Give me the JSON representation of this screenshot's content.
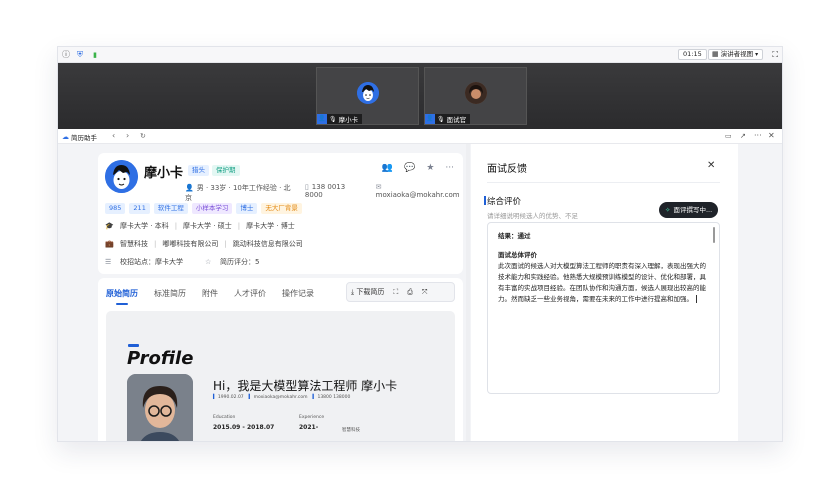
{
  "topbar": {
    "time": "01:15",
    "view_label": "演讲者视图",
    "view_caret": "▾"
  },
  "video": {
    "participants": [
      {
        "name": "摩小卡"
      },
      {
        "name": "面试官"
      }
    ]
  },
  "assistant": {
    "title": "简历助手"
  },
  "profile": {
    "name": "摩小卡",
    "badges": [
      "猎头",
      "保护期"
    ],
    "meta": {
      "basic": "男 · 33岁 · 10年工作经验 · 北京",
      "phone": "138 0013 8000",
      "email": "moxiaoka@mokahr.com"
    },
    "tags": [
      "985",
      "211",
      "软件工程",
      "小样本学习",
      "博士",
      "无大厂背景"
    ],
    "education": [
      "摩卡大学 · 本科",
      "摩卡大学 · 硕士",
      "摩卡大学 · 博士"
    ],
    "companies": [
      "智慧科技",
      "嘟嘟科技有限公司",
      "跳动科技信息有限公司"
    ],
    "site_label": "校招站点：摩卡大学",
    "score_label": "简历评分：5"
  },
  "resume": {
    "tabs": [
      "原始简历",
      "标准简历",
      "附件",
      "人才评价",
      "操作记录"
    ],
    "download_label": "下载简历",
    "preview": {
      "title": "Profile",
      "greeting": "Hi，我是大模型算法工程师 摩小卡",
      "birth": "1990.02.07",
      "email": "moxiaoka@mokahr.com",
      "phone": "13800 138000",
      "education_head": "Education",
      "education_date": "2015.09 - 2018.07",
      "experience_head": "Experience",
      "experience_date": "2021-",
      "experience_company": "智慧科技"
    }
  },
  "feedback": {
    "title": "面试反馈",
    "section": "综合评价",
    "hint": "请详细说明候选人的优势、不足",
    "writing_label": "面评撰写中...",
    "result_line": "结果：通过",
    "summary_title": "面试总体评价",
    "summary_body": "此次面试的候选人对大模型算法工程师的职责有深入理解，表现出强大的技术能力和实践经验。他熟悉大规模预训练模型的设计、优化和部署，具有丰富的实战项目经验。在团队协作和沟通方面，候选人展现出较高的能力。然而缺乏一些业务视角，需要在未来的工作中进行提高和加强。"
  },
  "colors": {
    "accent": "#1f5fd6",
    "brand_blue": "#2f6fe4",
    "panel_bg": "#f3f4f7"
  }
}
